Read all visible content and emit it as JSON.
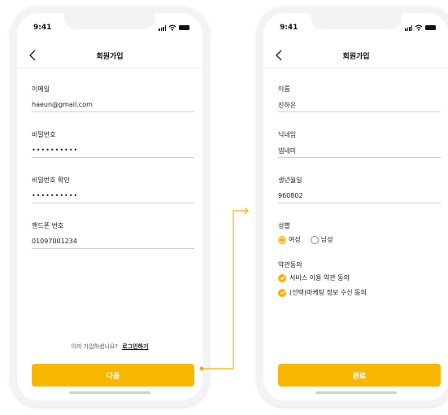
{
  "colors": {
    "accent": "#f7b700",
    "phone_frame": "#f3f3f3",
    "divider": "#cfcfcf"
  },
  "left_screen": {
    "status_time": "9:41",
    "title": "회원가입",
    "fields": [
      {
        "label": "이메일",
        "value": "haeun@gmail.com"
      },
      {
        "label": "비밀번호",
        "value": "••••••••••"
      },
      {
        "label": "비밀번호 확인",
        "value": "••••••••••"
      },
      {
        "label": "핸드폰 번호",
        "value": "01097001234"
      }
    ],
    "login_hint": "이미 가입하셨나요?",
    "login_link": "로그인하기",
    "next_button": "다음"
  },
  "right_screen": {
    "status_time": "9:41",
    "title": "회원가입",
    "fields": [
      {
        "label": "이름",
        "value": "진하은"
      },
      {
        "label": "닉네임",
        "value": "넴네미"
      },
      {
        "label": "생년월일",
        "value": "960802"
      }
    ],
    "gender": {
      "label": "성별",
      "options": [
        {
          "label": "여성",
          "selected": true
        },
        {
          "label": "남성",
          "selected": false
        }
      ]
    },
    "terms": {
      "label": "약관동의",
      "items": [
        {
          "label": "서비스 이용 약관 동의",
          "checked": true
        },
        {
          "label": "(선택)마케팅 정보 수신 동의",
          "checked": true
        }
      ]
    },
    "done_button": "완료"
  }
}
